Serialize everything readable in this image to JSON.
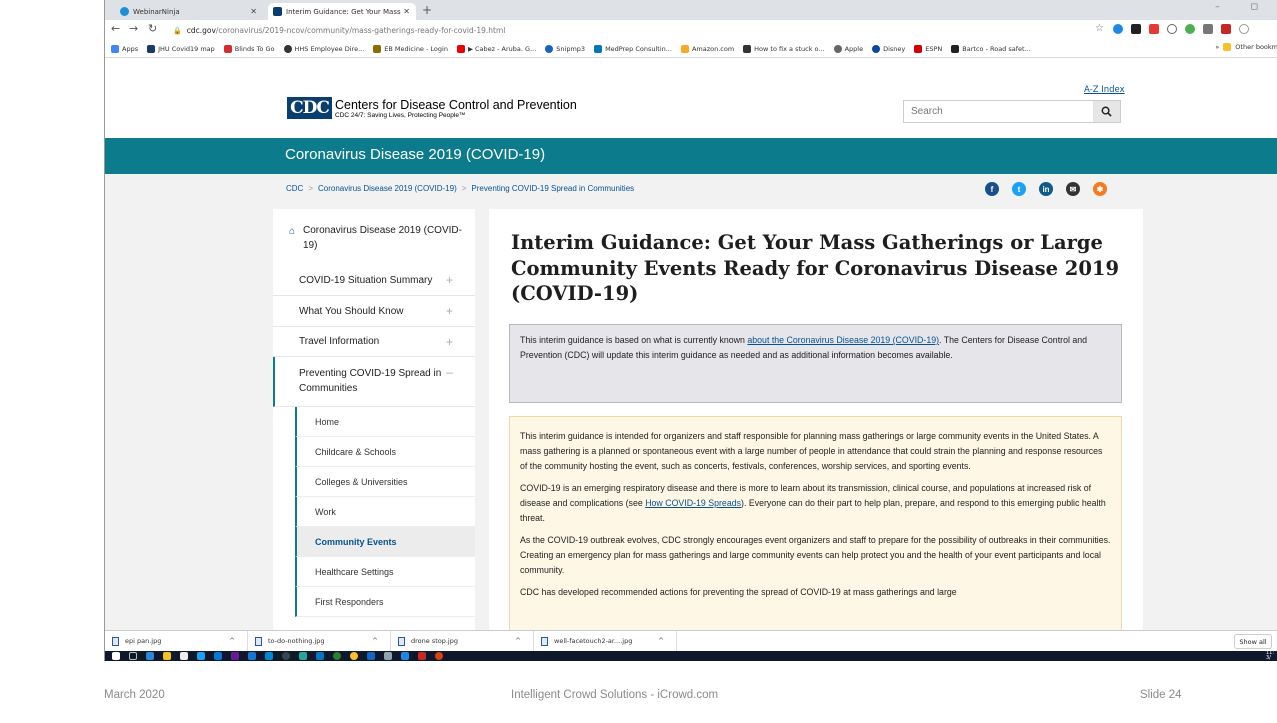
{
  "browser": {
    "tabs": [
      {
        "label": "WebinarNinja",
        "active": false
      },
      {
        "label": "Interim Guidance: Get Your Mass",
        "active": true
      }
    ],
    "new_tab": "+",
    "url_host": "cdc.gov",
    "url_path": "/coronavirus/2019-ncov/community/mass-gatherings-ready-for-covid-19.html",
    "bookmarks": [
      "Apps",
      "JHU Covid19 map",
      "Blinds To Go",
      "HHS Employee Dire...",
      "EB Medicine - Login",
      "▶ Cabez - Aruba. G...",
      "Snipmp3",
      "MedPrep Consultin...",
      "Amazon.com",
      "How to fix a stuck o...",
      "Apple",
      "Disney",
      "ESPN",
      "Bartco - Road safet..."
    ],
    "other_bookmarks": "Other bookm"
  },
  "site": {
    "logo_text": "CDC",
    "org_name": "Centers for Disease Control and Prevention",
    "tagline": "CDC 24/7: Saving Lives, Protecting People™",
    "az_index": "A-Z Index",
    "search_placeholder": "Search",
    "topic_title": "Coronavirus Disease 2019 (COVID-19)",
    "breadcrumbs": [
      "CDC",
      "Coronavirus Disease 2019 (COVID-19)",
      "Preventing COVID-19 Spread in Communities"
    ],
    "breadcrumb_sep": ">"
  },
  "leftnav": {
    "home": "Coronavirus Disease 2019 (COVID-19)",
    "sections": [
      {
        "label": "COVID-19 Situation Summary",
        "toggle": "+"
      },
      {
        "label": "What You Should Know",
        "toggle": "+"
      },
      {
        "label": "Travel Information",
        "toggle": "+"
      },
      {
        "label": "Preventing COVID-19 Spread in Communities",
        "toggle": "–"
      }
    ],
    "subitems": [
      {
        "label": "Home",
        "active": false
      },
      {
        "label": "Childcare & Schools",
        "active": false
      },
      {
        "label": "Colleges & Universities",
        "active": false
      },
      {
        "label": "Work",
        "active": false
      },
      {
        "label": "Community Events",
        "active": true
      },
      {
        "label": "Healthcare Settings",
        "active": false
      },
      {
        "label": "First Responders",
        "active": false
      }
    ]
  },
  "main": {
    "title": "Interim Guidance: Get Your Mass Gatherings or Large Community Events Ready for Coronavirus Disease 2019 (COVID-19)",
    "callout_before": "This interim guidance is based on what is currently known ",
    "callout_link": "about the Coronavirus Disease 2019 (COVID-19)",
    "callout_after": ". The Centers for Disease Control and Prevention (CDC) will update this interim guidance as needed and as additional information becomes available.",
    "p1": "This interim guidance is intended for organizers and staff responsible for planning mass gatherings or large community events in the United States. A mass gathering is a planned or spontaneous event with a large number of people in attendance that could strain the planning and response resources of the community hosting the event, such as concerts, festivals, conferences, worship services, and sporting events.",
    "p2_before": "COVID-19 is an emerging respiratory disease and there is more to learn about its transmission, clinical course, and populations at increased risk of disease and complications (see ",
    "p2_link": "How COVID-19 Spreads",
    "p2_after": "). Everyone can do their part to help plan, prepare, and respond to this emerging public health threat.",
    "p3": "As the COVID-19 outbreak evolves, CDC strongly encourages event organizers and staff to prepare for the possibility of outbreaks in their communities. Creating an emergency plan for mass gatherings and large community events can help protect you and the health of your event participants and local community.",
    "p4": "CDC has developed recommended actions for preventing the spread of COVID-19 at mass gatherings and large"
  },
  "downloads": {
    "files": [
      "epi pan.jpg",
      "to-do-nothing.jpg",
      "drone stop.jpg",
      "well-facetouch2-ar....jpg"
    ],
    "show_all": "Show all"
  },
  "taskbar": {
    "clock_time": "11:",
    "clock_date": "3/"
  },
  "slide_footer": {
    "date": "March 2020",
    "center": "Intelligent Crowd Solutions - iCrowd.com",
    "slide": "Slide 24"
  },
  "colors": {
    "cdc_teal": "#0c7c8c",
    "cdc_navy": "#0a3e6f",
    "link_blue": "#075290",
    "callout_bg": "#e6e6ea",
    "summary_bg": "#fff7e6"
  }
}
